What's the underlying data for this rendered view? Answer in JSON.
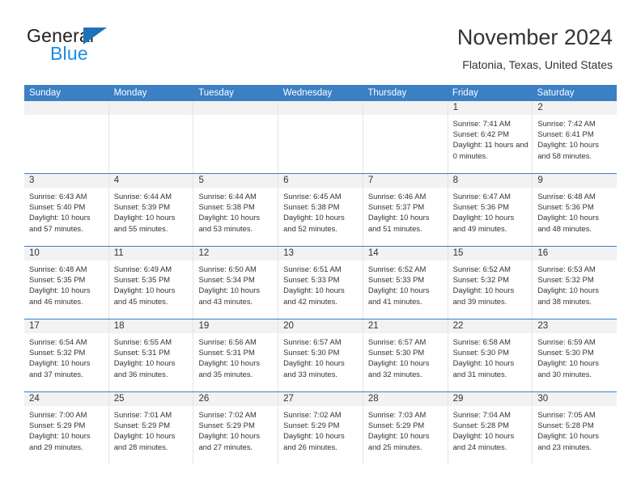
{
  "brand": {
    "name_top": "General",
    "name_bottom": "Blue",
    "triangle_color": "#1e72bb",
    "blue_color": "#1b8ce3"
  },
  "header": {
    "title": "November 2024",
    "subtitle": "Flatonia, Texas, United States"
  },
  "theme": {
    "header_bg": "#3b7fc4",
    "day_band_bg": "#f2f2f2",
    "row_separator": "#3b7fc4",
    "text": "#333333"
  },
  "weekdays": [
    "Sunday",
    "Monday",
    "Tuesday",
    "Wednesday",
    "Thursday",
    "Friday",
    "Saturday"
  ],
  "labels": {
    "sunrise_prefix": "Sunrise:",
    "sunset_prefix": "Sunset:",
    "daylight_prefix": "Daylight:"
  },
  "weeks": [
    [
      {
        "day": "",
        "sunrise": "",
        "sunset": "",
        "daylight": ""
      },
      {
        "day": "",
        "sunrise": "",
        "sunset": "",
        "daylight": ""
      },
      {
        "day": "",
        "sunrise": "",
        "sunset": "",
        "daylight": ""
      },
      {
        "day": "",
        "sunrise": "",
        "sunset": "",
        "daylight": ""
      },
      {
        "day": "",
        "sunrise": "",
        "sunset": "",
        "daylight": ""
      },
      {
        "day": "1",
        "sunrise": "Sunrise: 7:41 AM",
        "sunset": "Sunset: 6:42 PM",
        "daylight": "Daylight: 11 hours and 0 minutes."
      },
      {
        "day": "2",
        "sunrise": "Sunrise: 7:42 AM",
        "sunset": "Sunset: 6:41 PM",
        "daylight": "Daylight: 10 hours and 58 minutes."
      }
    ],
    [
      {
        "day": "3",
        "sunrise": "Sunrise: 6:43 AM",
        "sunset": "Sunset: 5:40 PM",
        "daylight": "Daylight: 10 hours and 57 minutes."
      },
      {
        "day": "4",
        "sunrise": "Sunrise: 6:44 AM",
        "sunset": "Sunset: 5:39 PM",
        "daylight": "Daylight: 10 hours and 55 minutes."
      },
      {
        "day": "5",
        "sunrise": "Sunrise: 6:44 AM",
        "sunset": "Sunset: 5:38 PM",
        "daylight": "Daylight: 10 hours and 53 minutes."
      },
      {
        "day": "6",
        "sunrise": "Sunrise: 6:45 AM",
        "sunset": "Sunset: 5:38 PM",
        "daylight": "Daylight: 10 hours and 52 minutes."
      },
      {
        "day": "7",
        "sunrise": "Sunrise: 6:46 AM",
        "sunset": "Sunset: 5:37 PM",
        "daylight": "Daylight: 10 hours and 51 minutes."
      },
      {
        "day": "8",
        "sunrise": "Sunrise: 6:47 AM",
        "sunset": "Sunset: 5:36 PM",
        "daylight": "Daylight: 10 hours and 49 minutes."
      },
      {
        "day": "9",
        "sunrise": "Sunrise: 6:48 AM",
        "sunset": "Sunset: 5:36 PM",
        "daylight": "Daylight: 10 hours and 48 minutes."
      }
    ],
    [
      {
        "day": "10",
        "sunrise": "Sunrise: 6:48 AM",
        "sunset": "Sunset: 5:35 PM",
        "daylight": "Daylight: 10 hours and 46 minutes."
      },
      {
        "day": "11",
        "sunrise": "Sunrise: 6:49 AM",
        "sunset": "Sunset: 5:35 PM",
        "daylight": "Daylight: 10 hours and 45 minutes."
      },
      {
        "day": "12",
        "sunrise": "Sunrise: 6:50 AM",
        "sunset": "Sunset: 5:34 PM",
        "daylight": "Daylight: 10 hours and 43 minutes."
      },
      {
        "day": "13",
        "sunrise": "Sunrise: 6:51 AM",
        "sunset": "Sunset: 5:33 PM",
        "daylight": "Daylight: 10 hours and 42 minutes."
      },
      {
        "day": "14",
        "sunrise": "Sunrise: 6:52 AM",
        "sunset": "Sunset: 5:33 PM",
        "daylight": "Daylight: 10 hours and 41 minutes."
      },
      {
        "day": "15",
        "sunrise": "Sunrise: 6:52 AM",
        "sunset": "Sunset: 5:32 PM",
        "daylight": "Daylight: 10 hours and 39 minutes."
      },
      {
        "day": "16",
        "sunrise": "Sunrise: 6:53 AM",
        "sunset": "Sunset: 5:32 PM",
        "daylight": "Daylight: 10 hours and 38 minutes."
      }
    ],
    [
      {
        "day": "17",
        "sunrise": "Sunrise: 6:54 AM",
        "sunset": "Sunset: 5:32 PM",
        "daylight": "Daylight: 10 hours and 37 minutes."
      },
      {
        "day": "18",
        "sunrise": "Sunrise: 6:55 AM",
        "sunset": "Sunset: 5:31 PM",
        "daylight": "Daylight: 10 hours and 36 minutes."
      },
      {
        "day": "19",
        "sunrise": "Sunrise: 6:56 AM",
        "sunset": "Sunset: 5:31 PM",
        "daylight": "Daylight: 10 hours and 35 minutes."
      },
      {
        "day": "20",
        "sunrise": "Sunrise: 6:57 AM",
        "sunset": "Sunset: 5:30 PM",
        "daylight": "Daylight: 10 hours and 33 minutes."
      },
      {
        "day": "21",
        "sunrise": "Sunrise: 6:57 AM",
        "sunset": "Sunset: 5:30 PM",
        "daylight": "Daylight: 10 hours and 32 minutes."
      },
      {
        "day": "22",
        "sunrise": "Sunrise: 6:58 AM",
        "sunset": "Sunset: 5:30 PM",
        "daylight": "Daylight: 10 hours and 31 minutes."
      },
      {
        "day": "23",
        "sunrise": "Sunrise: 6:59 AM",
        "sunset": "Sunset: 5:30 PM",
        "daylight": "Daylight: 10 hours and 30 minutes."
      }
    ],
    [
      {
        "day": "24",
        "sunrise": "Sunrise: 7:00 AM",
        "sunset": "Sunset: 5:29 PM",
        "daylight": "Daylight: 10 hours and 29 minutes."
      },
      {
        "day": "25",
        "sunrise": "Sunrise: 7:01 AM",
        "sunset": "Sunset: 5:29 PM",
        "daylight": "Daylight: 10 hours and 28 minutes."
      },
      {
        "day": "26",
        "sunrise": "Sunrise: 7:02 AM",
        "sunset": "Sunset: 5:29 PM",
        "daylight": "Daylight: 10 hours and 27 minutes."
      },
      {
        "day": "27",
        "sunrise": "Sunrise: 7:02 AM",
        "sunset": "Sunset: 5:29 PM",
        "daylight": "Daylight: 10 hours and 26 minutes."
      },
      {
        "day": "28",
        "sunrise": "Sunrise: 7:03 AM",
        "sunset": "Sunset: 5:29 PM",
        "daylight": "Daylight: 10 hours and 25 minutes."
      },
      {
        "day": "29",
        "sunrise": "Sunrise: 7:04 AM",
        "sunset": "Sunset: 5:28 PM",
        "daylight": "Daylight: 10 hours and 24 minutes."
      },
      {
        "day": "30",
        "sunrise": "Sunrise: 7:05 AM",
        "sunset": "Sunset: 5:28 PM",
        "daylight": "Daylight: 10 hours and 23 minutes."
      }
    ]
  ]
}
